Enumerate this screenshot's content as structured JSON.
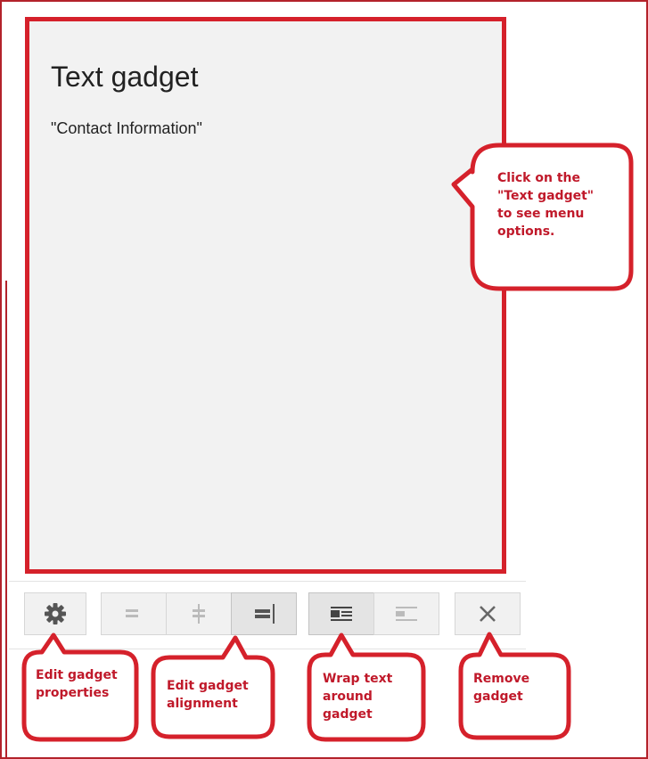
{
  "gadget": {
    "title": "Text gadget",
    "subtitle": "\"Contact Information\""
  },
  "toolbar": {
    "settings_icon": "gear-icon",
    "align_left_icon": "align-left-icon",
    "align_center_icon": "align-center-icon",
    "align_right_icon": "align-right-icon",
    "wrap_text_icon": "wrap-text-icon",
    "no_wrap_icon": "no-wrap-icon",
    "remove_icon": "close-icon",
    "active_alignment": "right",
    "active_wrap": "wrap"
  },
  "callouts": {
    "menu_hint": [
      "Click on the",
      "\"Text gadget\"",
      "to see menu",
      "options."
    ],
    "edit_properties": [
      "Edit gadget",
      "properties"
    ],
    "edit_alignment": [
      "Edit gadget",
      "alignment"
    ],
    "wrap_text": [
      "Wrap text",
      "around",
      "gadget"
    ],
    "remove_gadget": [
      "Remove",
      "gadget"
    ]
  },
  "colors": {
    "callout_red": "#d5212b",
    "callout_text": "#c0192a",
    "gadget_bg": "#f2f2f2"
  }
}
